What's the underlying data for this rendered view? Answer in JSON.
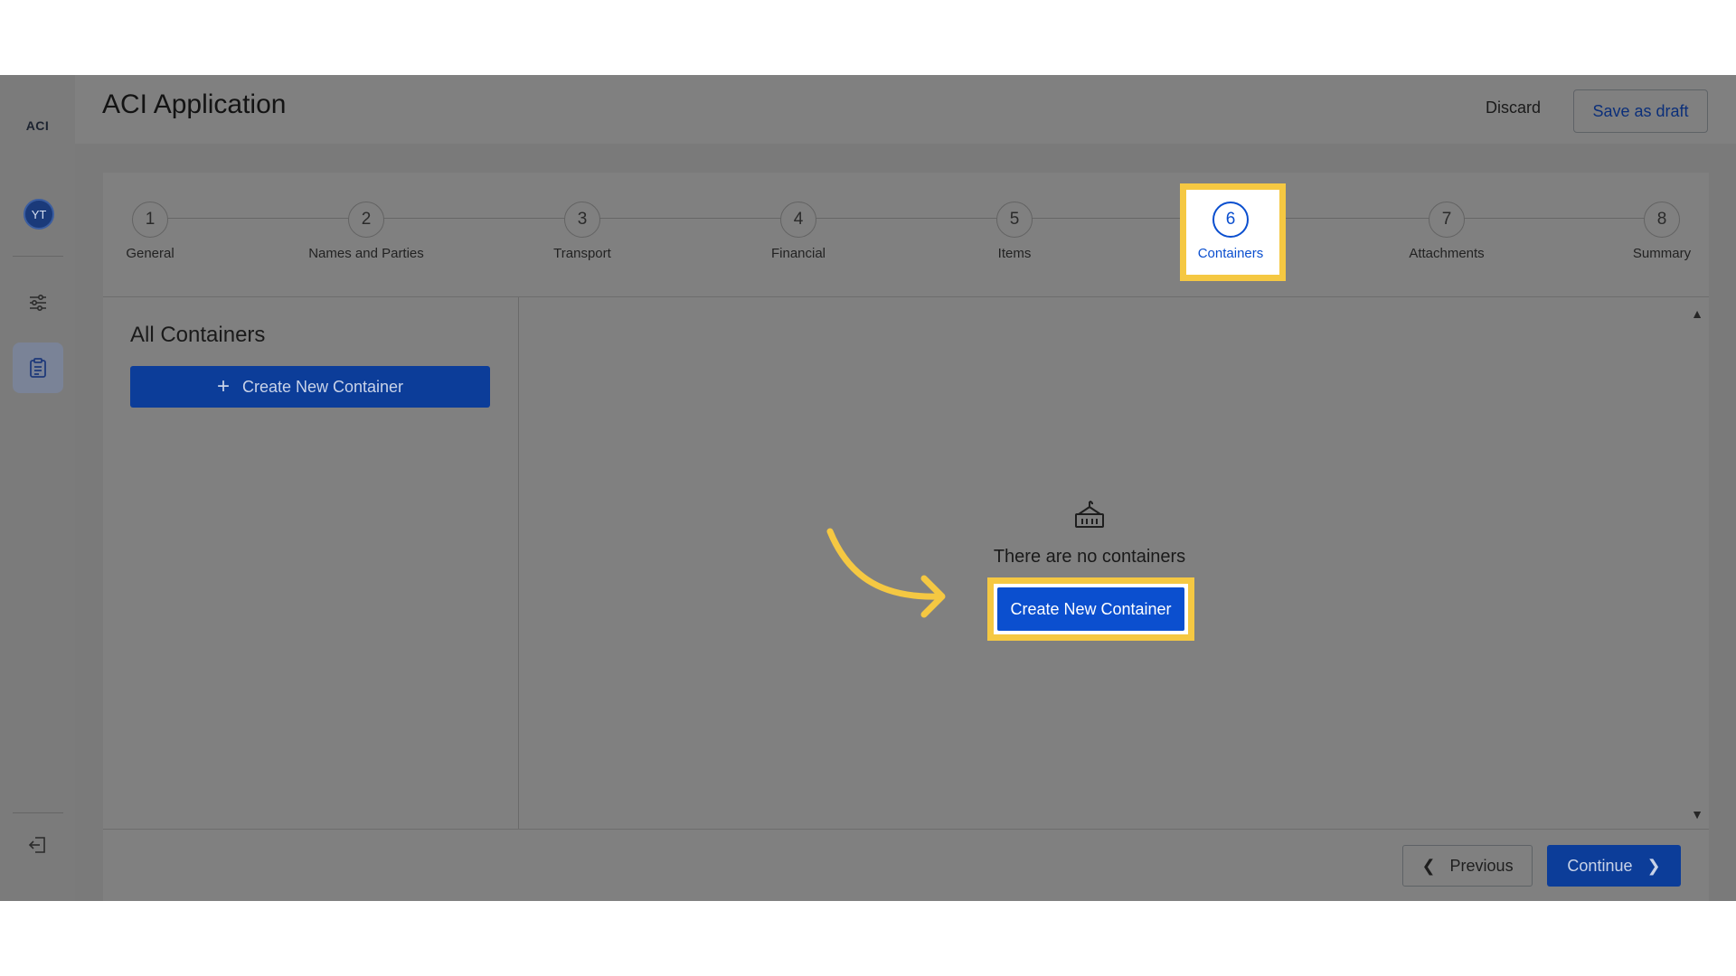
{
  "app": {
    "logo": "ACI",
    "avatar_initials": "YT",
    "title": "ACI Application"
  },
  "header": {
    "discard_label": "Discard",
    "save_draft_label": "Save as draft"
  },
  "sidebar": {
    "icons": [
      "sliders-icon",
      "clipboard-icon",
      "logout-icon"
    ]
  },
  "stepper": {
    "active_step": 6,
    "steps": [
      {
        "number": "1",
        "label": "General"
      },
      {
        "number": "2",
        "label": "Names and Parties"
      },
      {
        "number": "3",
        "label": "Transport"
      },
      {
        "number": "4",
        "label": "Financial"
      },
      {
        "number": "5",
        "label": "Items"
      },
      {
        "number": "6",
        "label": "Containers"
      },
      {
        "number": "7",
        "label": "Attachments"
      },
      {
        "number": "8",
        "label": "Summary"
      }
    ]
  },
  "containers": {
    "title": "All Containers",
    "create_button_label": "Create New Container",
    "empty_message": "There are no containers",
    "empty_create_label": "Create New Container"
  },
  "footer": {
    "previous_label": "Previous",
    "continue_label": "Continue"
  },
  "colors": {
    "accent_blue": "#0b4fcf",
    "highlight_yellow": "#f5c842",
    "overlay_gray": "#808080"
  }
}
